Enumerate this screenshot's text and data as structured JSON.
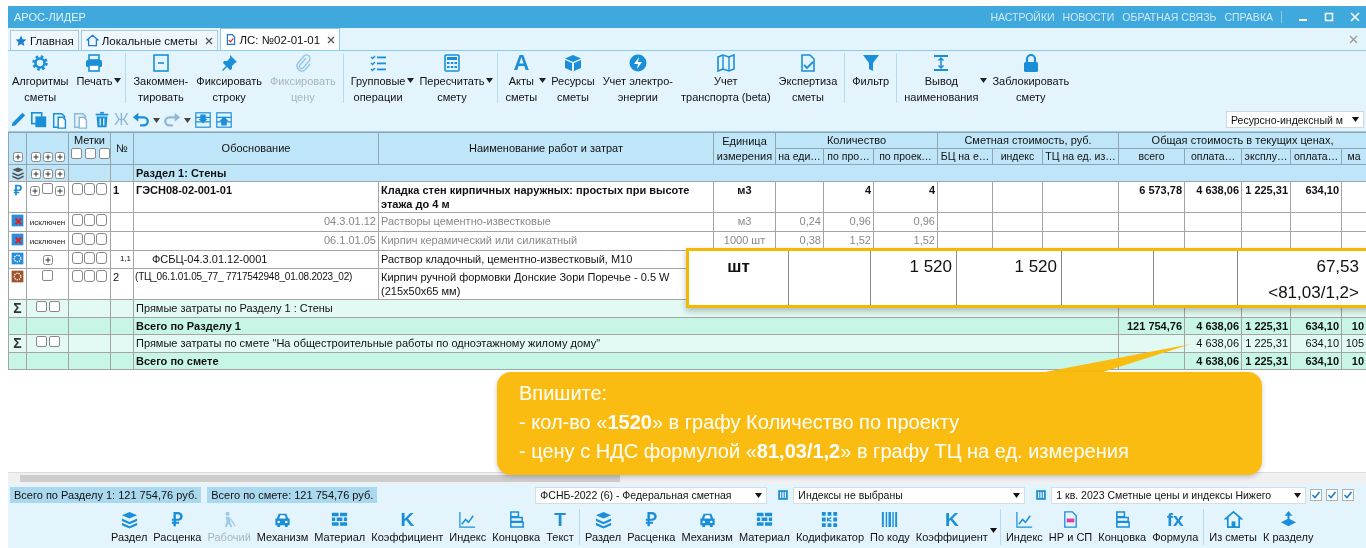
{
  "title_bar": {
    "title": "АРОС-ЛИДЕР",
    "menu": [
      "НАСТРОЙКИ",
      "НОВОСТИ",
      "ОБРАТНАЯ СВЯЗЬ",
      "СПРАВКА"
    ]
  },
  "tabs": [
    {
      "label": "Главная",
      "selected": false,
      "closable": false
    },
    {
      "label": "Локальные сметы",
      "selected": false,
      "closable": true
    },
    {
      "label": "ЛС: №02-01-01",
      "selected": true,
      "closable": true
    }
  ],
  "ribbon": [
    [
      {
        "label": "Алгоритмы\nсметы",
        "disabled": false,
        "dropdown": false
      },
      {
        "label": "Печать",
        "disabled": false,
        "dropdown": true
      }
    ],
    [
      {
        "label": "Закоммен-\nтировать",
        "disabled": false,
        "dropdown": false
      },
      {
        "label": "Фиксировать\nстроку",
        "disabled": false,
        "dropdown": false
      },
      {
        "label": "Фиксировать\nцену",
        "disabled": true,
        "dropdown": false
      }
    ],
    [
      {
        "label": "Групповые\nоперации",
        "disabled": false,
        "dropdown": true
      },
      {
        "label": "Пересчитать\nсмету",
        "disabled": false,
        "dropdown": true
      }
    ],
    [
      {
        "label": "Акты\nсметы",
        "disabled": false,
        "dropdown": true,
        "glyph": "A"
      },
      {
        "label": "Ресурсы\nсметы",
        "disabled": false,
        "dropdown": false
      },
      {
        "label": "Учет электро-\nэнергии",
        "disabled": false,
        "dropdown": false
      },
      {
        "label": "Учет\nтранспорта (beta)",
        "disabled": false,
        "dropdown": false
      },
      {
        "label": "Экспертиза\nсметы",
        "disabled": false,
        "dropdown": false
      }
    ],
    [
      {
        "label": "Фильтр",
        "disabled": false,
        "dropdown": false
      }
    ],
    [
      {
        "label": "Вывод\nнаименования",
        "disabled": false,
        "dropdown": true
      },
      {
        "label": "Заблокировать\nсмету",
        "disabled": false,
        "dropdown": false
      }
    ]
  ],
  "toolbar": [
    {
      "disabled": false
    },
    {
      "disabled": false
    },
    {
      "disabled": false
    },
    {
      "disabled": true
    },
    {
      "disabled": false
    },
    {
      "disabled": true,
      "glyph": "Ж"
    },
    {
      "disabled": false,
      "dropdown": true
    },
    {
      "disabled": true,
      "dropdown": true
    },
    {
      "disabled": false
    },
    {
      "disabled": false
    }
  ],
  "calc_mode": "Ресурсно-индексный м",
  "table": {
    "header": {
      "marks": "Метки",
      "number": "№",
      "basis": "Обоснование",
      "name": "Наименование работ и затрат",
      "unit": "Единица измерения",
      "groups": [
        {
          "title": "Количество",
          "columns": [
            "на еди…",
            "по про…",
            "по проек…"
          ]
        },
        {
          "title": "Сметная стоимость, руб.",
          "columns": [
            "БЦ на е…",
            "индекс",
            "ТЦ на ед. из…"
          ]
        },
        {
          "title": "Общая стоимость в текущих ценах,",
          "columns": [
            "всего",
            "оплата…",
            "эксплу…",
            "оплата…",
            "ма"
          ]
        }
      ]
    },
    "rows": [
      {
        "kind": "section",
        "text": "Раздел 1: Стены"
      },
      {
        "kind": "item",
        "glyph": "₽",
        "marks": [
          false,
          false,
          false
        ],
        "cells": {
          "no": "1",
          "basis": "ГЭСН08-02-001-01",
          "name": "Кладка стен кирпичных наружных: простых при высоте этажа до 4 м",
          "unit": "м3",
          "q2": "4",
          "q3": "4",
          "total": "6 573,78",
          "c1": "4 638,06",
          "c2": "1 225,31",
          "c3": "634,10"
        }
      },
      {
        "kind": "excluded",
        "flag": "исключен",
        "marks": [
          false,
          false,
          false
        ],
        "cells": {
          "basis": "04.3.01.12",
          "name": "Растворы цементно-известковые",
          "unit": "м3",
          "q1": "0,24",
          "q2": "0,96",
          "q3": "0,96"
        }
      },
      {
        "kind": "excluded",
        "flag": "исключен",
        "marks": [
          false,
          false,
          false
        ],
        "cells": {
          "basis": "06.1.01.05",
          "name": "Кирпич керамический или силикатный",
          "unit": "1000 шт",
          "q1": "0,38",
          "q2": "1,52",
          "q3": "1,52"
        }
      },
      {
        "kind": "resource",
        "marks": [
          false,
          false,
          false
        ],
        "cells": {
          "no": "1,1",
          "basis": "ФСБЦ-04.3.01.12-0001",
          "name": "Раствор кладочный, цементно-известковый, М10"
        }
      },
      {
        "kind": "material",
        "marks": [
          false,
          false,
          false
        ],
        "cells": {
          "no": "2",
          "basis": "(ТЦ_06.1.01.05_77_ 7717542948_01.08.2023_02)",
          "name": "Кирпич ручной формовки Донские Зори Поречье - 0.5 W\n(215x50x65 мм)"
        }
      },
      {
        "kind": "direct",
        "glyph": "Σ",
        "text": "Прямые затраты по Разделу 1 : Стены",
        "cells": {}
      },
      {
        "kind": "total",
        "text": "Всего по Разделу 1",
        "cells": {
          "total": "121 754,76",
          "c1": "4 638,06",
          "c2": "1 225,31",
          "c3": "634,10",
          "c4": "10"
        }
      },
      {
        "kind": "direct",
        "glyph": "Σ",
        "text": "Прямые затраты по смете \"На общестроительные работы по одноэтажному жилому дому\"",
        "cells": {
          "c1": "4 638,06",
          "c2": "1 225,31",
          "c3": "634,10",
          "c4": "105"
        }
      },
      {
        "kind": "total",
        "text": "Всего по смете",
        "cells": {
          "c1": "4 638,06",
          "c2": "1 225,31",
          "c3": "634,10",
          "c4": "10"
        }
      }
    ]
  },
  "magnifier": {
    "unit": "шт",
    "qty_a": "1 520",
    "qty_b": "1 520",
    "price": "67,53",
    "formula": "<81,03/1,2>"
  },
  "callout": {
    "lines": [
      "Впишите:",
      "- кол-во «**1520**» в графу Количество по проекту",
      "- цену с НДС формулой «**81,03/1,2**» в графу ТЦ на ед. измерения"
    ]
  },
  "status": {
    "totals": [
      "Всего по Разделу 1: 121 754,76 руб.",
      "Всего по смете: 121 754,76 руб."
    ],
    "norm_base": "ФСНБ-2022 (6) - Федеральная сметная",
    "indexes": "Индексы не выбраны",
    "prices": "1 кв. 2023 Сметные цены и индексы Нижего",
    "checks": [
      {
        "checked": true
      },
      {
        "checked": true
      },
      {
        "checked": true
      }
    ]
  },
  "insert_bar": [
    [
      {
        "label": "Раздел",
        "disabled": false
      },
      {
        "label": "Расценка",
        "disabled": false,
        "glyph": "₽"
      },
      {
        "label": "Рабочий",
        "disabled": true
      },
      {
        "label": "Механизм",
        "disabled": false
      },
      {
        "label": "Материал",
        "disabled": false
      },
      {
        "label": "Коэффициент",
        "disabled": false,
        "glyph": "K"
      },
      {
        "label": "Индекс",
        "disabled": false
      },
      {
        "label": "Концовка",
        "disabled": false
      },
      {
        "label": "Текст",
        "disabled": false,
        "glyph": "T"
      }
    ],
    [
      {
        "label": "Раздел",
        "disabled": false
      },
      {
        "label": "Расценка",
        "disabled": false,
        "glyph": "₽"
      },
      {
        "label": "Механизм",
        "disabled": false
      },
      {
        "label": "Материал",
        "disabled": false
      },
      {
        "label": "Кодификатор",
        "disabled": false
      },
      {
        "label": "По коду",
        "disabled": false
      },
      {
        "label": "Коэффициент",
        "disabled": false,
        "glyph": "K",
        "dropdown": true
      }
    ],
    [
      {
        "label": "Индекс",
        "disabled": false
      },
      {
        "label": "НР и СП",
        "disabled": false
      },
      {
        "label": "Концовка",
        "disabled": false
      },
      {
        "label": "Формула",
        "disabled": false,
        "glyph": "fx"
      }
    ],
    [
      {
        "label": "Из сметы",
        "disabled": false
      },
      {
        "label": "К разделу",
        "disabled": false
      }
    ]
  ]
}
